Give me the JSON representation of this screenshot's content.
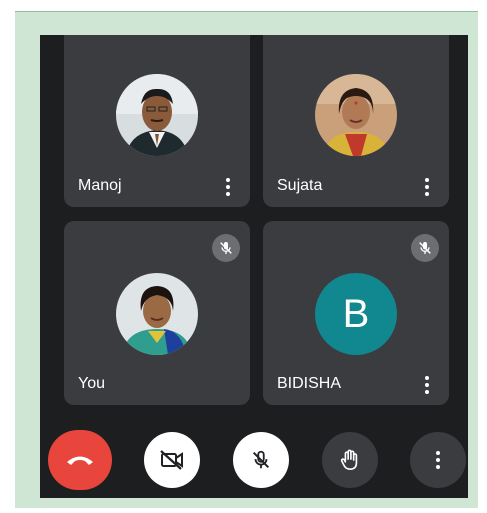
{
  "participants": [
    {
      "name": "Manoj",
      "muted": false,
      "avatar": "photo"
    },
    {
      "name": "Sujata",
      "muted": false,
      "avatar": "photo"
    },
    {
      "name": "You",
      "muted": true,
      "avatar": "photo"
    },
    {
      "name": "BIDISHA",
      "muted": true,
      "avatar": "letter",
      "initial": "B",
      "color": "#11878f"
    }
  ],
  "controls": {
    "end_call": "phone-hangup-icon",
    "camera": "camera-off-icon",
    "microphone": "mic-off-icon",
    "raise_hand": "hand-icon",
    "more": "more-vert-icon"
  },
  "colors": {
    "end_call": "#e8453c",
    "tile": "#3b3c3f",
    "background": "#1d1e20",
    "frame": "#cfe6d4"
  }
}
